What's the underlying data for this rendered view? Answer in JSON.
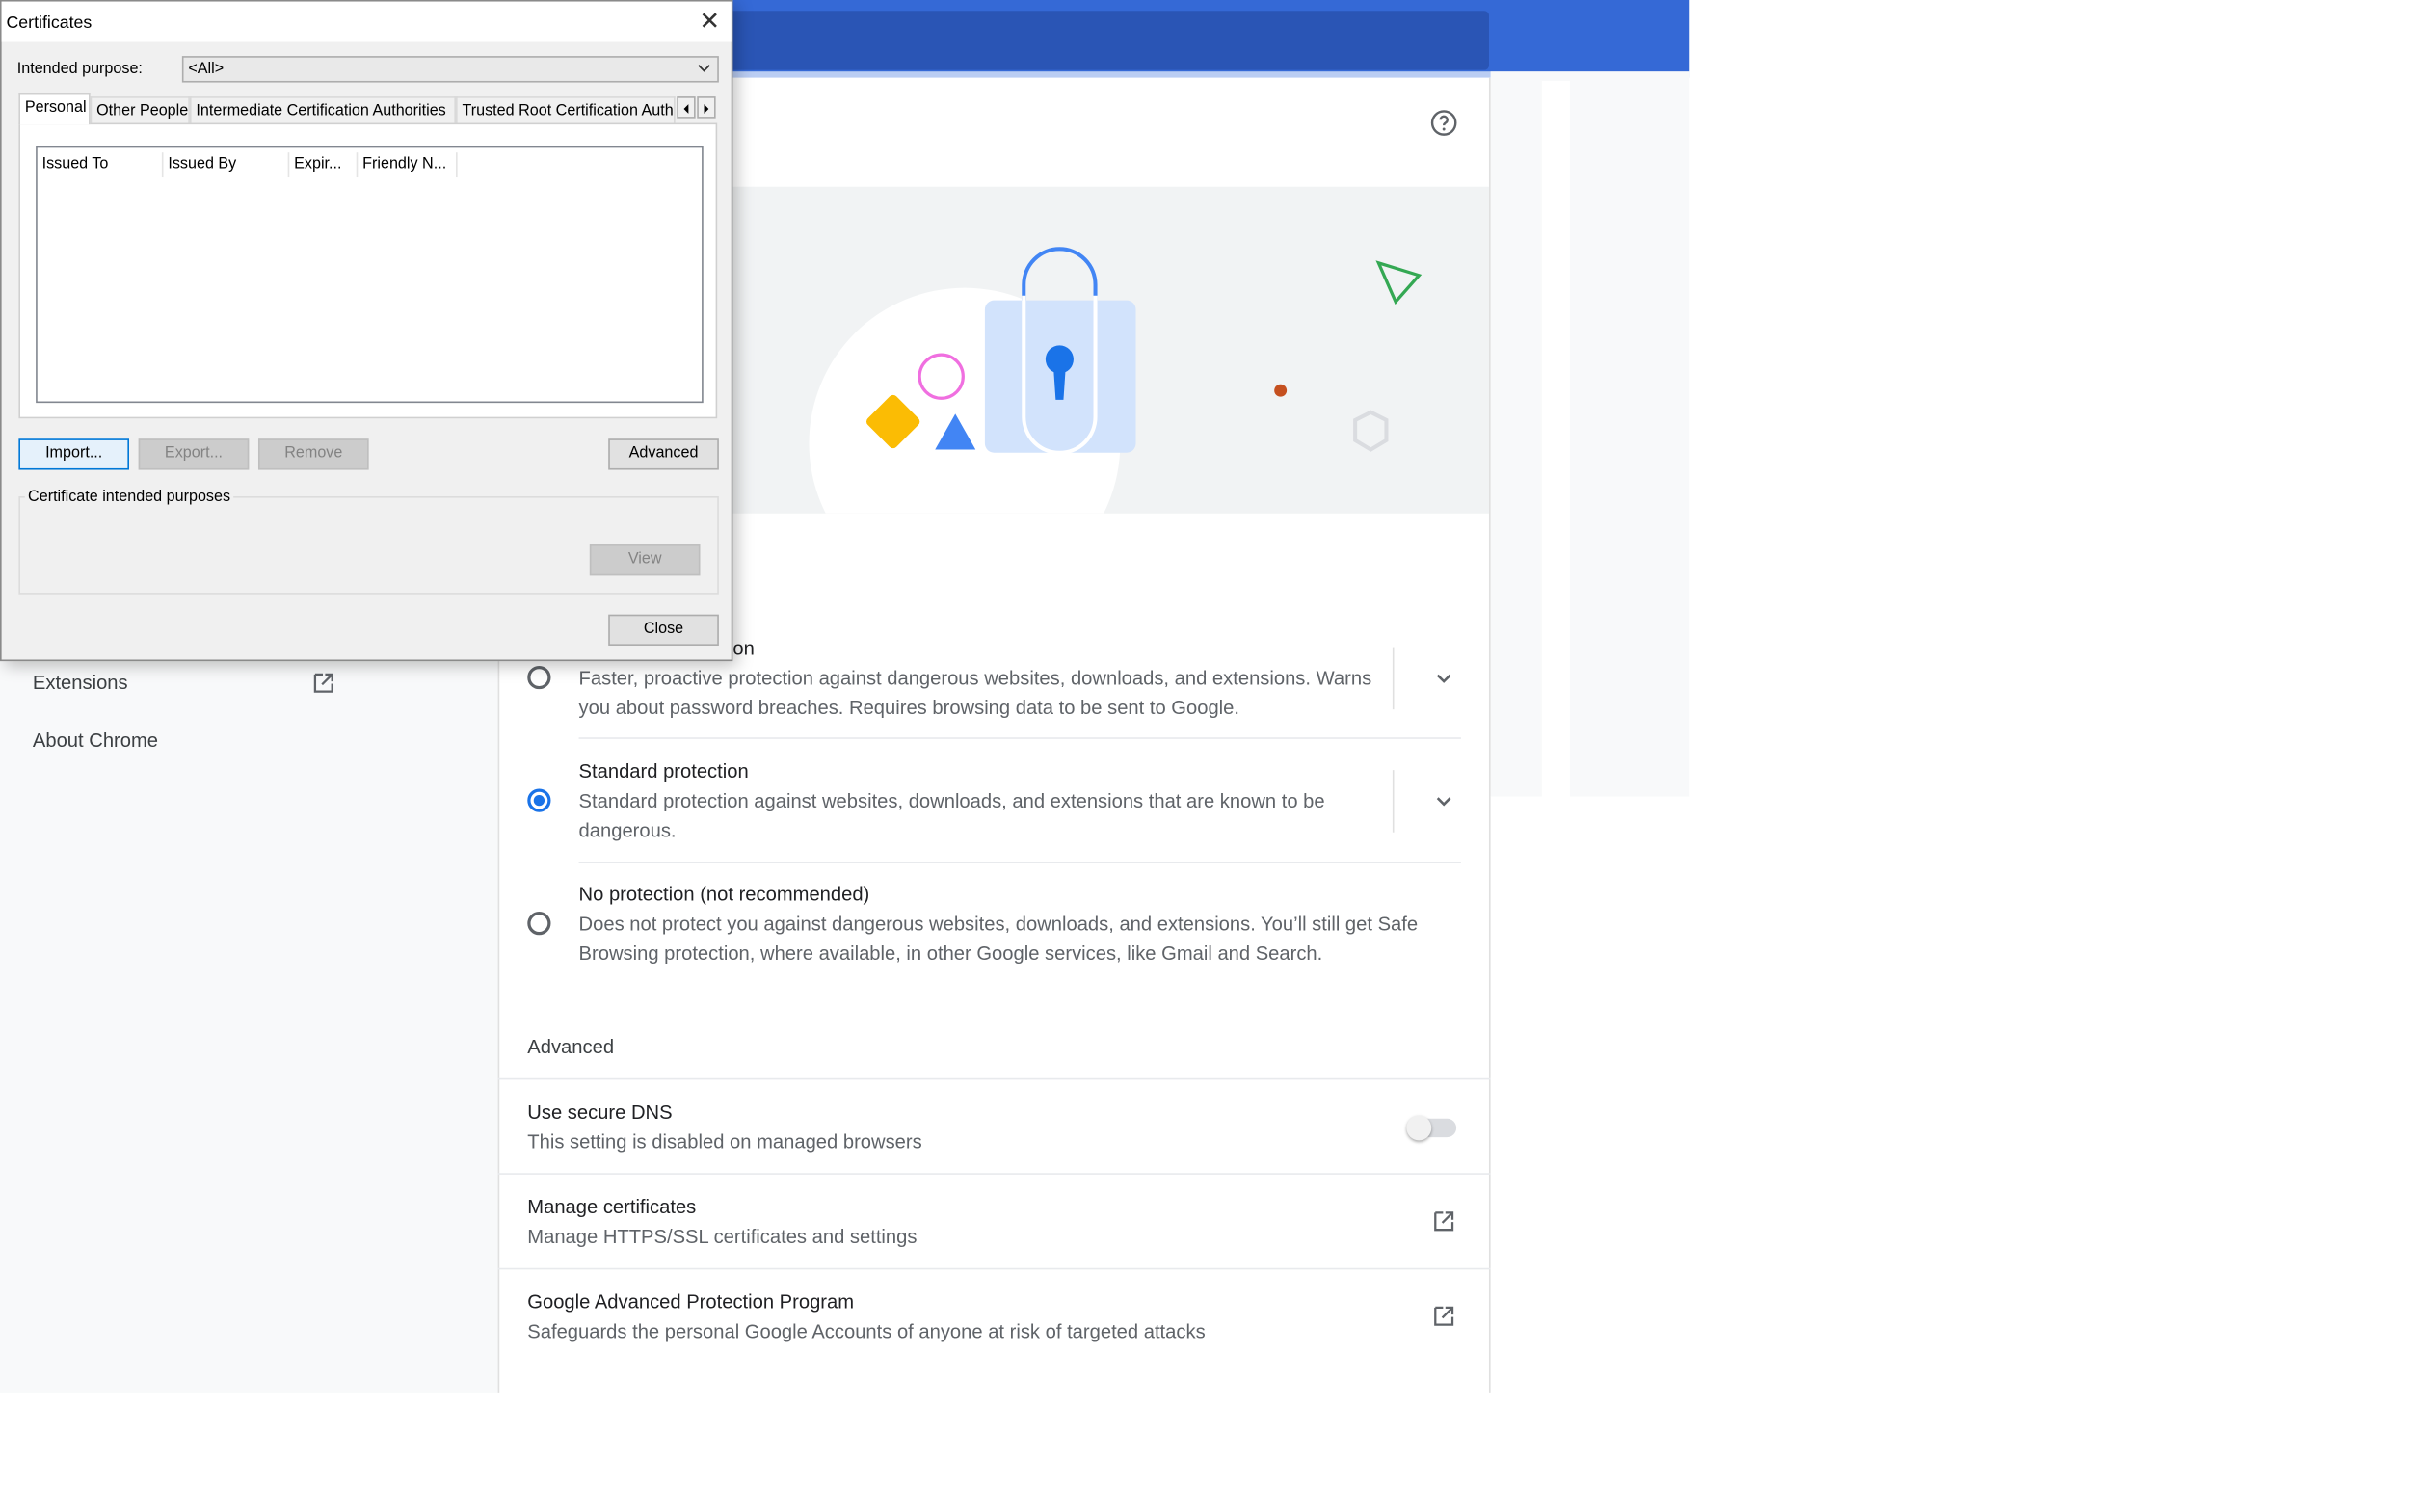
{
  "colors": {
    "accent": "#1a73e8",
    "topbar": "#3569d6",
    "search_box": "#2a55b5",
    "dialog_default_border": "#0078d7"
  },
  "sidebar": {
    "items": [
      {
        "label": "Extensions",
        "icon": "open-in-new-icon"
      },
      {
        "label": "About Chrome"
      }
    ]
  },
  "header": {
    "help_icon": "help-icon"
  },
  "safe_browsing": {
    "enhanced": {
      "title_fragment": "on",
      "desc": "Faster, proactive protection against dangerous websites, downloads, and extensions. Warns you about password breaches. Requires browsing data to be sent to Google.",
      "selected": false
    },
    "standard": {
      "title": "Standard protection",
      "desc": "Standard protection against websites, downloads, and extensions that are known to be dangerous.",
      "selected": true
    },
    "none": {
      "title": "No protection (not recommended)",
      "desc": "Does not protect you against dangerous websites, downloads, and extensions. You’ll still get Safe Browsing protection, where available, in other Google services, like Gmail and Search.",
      "selected": false
    }
  },
  "advanced": {
    "title": "Advanced",
    "secure_dns": {
      "title": "Use secure DNS",
      "desc": "This setting is disabled on managed browsers",
      "enabled": false
    },
    "manage_certs": {
      "title": "Manage certificates",
      "desc": "Manage HTTPS/SSL certificates and settings"
    },
    "gapp": {
      "title": "Google Advanced Protection Program",
      "desc": "Safeguards the personal Google Accounts of anyone at risk of targeted attacks"
    }
  },
  "dialog": {
    "title": "Certificates",
    "close_glyph": "✕",
    "purpose_label": "Intended purpose:",
    "purpose_value": "<All>",
    "tabs": [
      "Personal",
      "Other People",
      "Intermediate Certification Authorities",
      "Trusted Root Certification Authorities"
    ],
    "tabs_visible": [
      "Personal",
      "Other People",
      "Intermediate Certification Authorities",
      "Trusted Root Certification Auth"
    ],
    "active_tab": "Personal",
    "columns": [
      "Issued To",
      "Issued By",
      "Expir...",
      "Friendly N..."
    ],
    "buttons": {
      "import": "Import...",
      "export": "Export...",
      "remove": "Remove",
      "advanced": "Advanced",
      "view": "View",
      "close": "Close"
    },
    "group_label": "Certificate intended purposes"
  }
}
